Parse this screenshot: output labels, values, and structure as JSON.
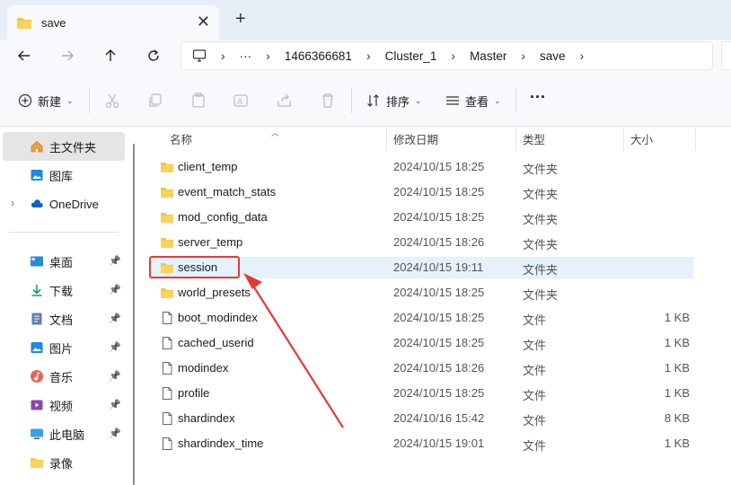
{
  "tab": {
    "title": "save",
    "close": "✕",
    "new_tab": "+"
  },
  "address": {
    "crumbs": [
      "1466366681",
      "Cluster_1",
      "Master",
      "save"
    ],
    "ellipsis": "···"
  },
  "toolbar": {
    "new_label": "新建",
    "sort_label": "排序",
    "view_label": "查看",
    "more": "···"
  },
  "sidebar": {
    "items": [
      {
        "label": "主文件夹",
        "icon": "home-icon",
        "pinned": false,
        "selected": true
      },
      {
        "label": "图库",
        "icon": "gallery-icon",
        "pinned": false
      },
      {
        "label": "OneDrive",
        "icon": "cloud-icon",
        "pinned": false,
        "expandable": true
      },
      {
        "label": "桌面",
        "icon": "desktop-icon",
        "pinned": true
      },
      {
        "label": "下载",
        "icon": "download-icon",
        "pinned": true
      },
      {
        "label": "文档",
        "icon": "document-icon",
        "pinned": true
      },
      {
        "label": "图片",
        "icon": "pictures-icon",
        "pinned": true
      },
      {
        "label": "音乐",
        "icon": "music-icon",
        "pinned": true
      },
      {
        "label": "视频",
        "icon": "video-icon",
        "pinned": true
      },
      {
        "label": "此电脑",
        "icon": "computer-icon",
        "pinned": true
      },
      {
        "label": "录像",
        "icon": "folder-icon",
        "pinned": false
      }
    ]
  },
  "columns": {
    "name": "名称",
    "date": "修改日期",
    "type": "类型",
    "size": "大小"
  },
  "files": [
    {
      "name": "client_temp",
      "date": "2024/10/15 18:25",
      "type": "文件夹",
      "size": "",
      "kind": "folder"
    },
    {
      "name": "event_match_stats",
      "date": "2024/10/15 18:25",
      "type": "文件夹",
      "size": "",
      "kind": "folder"
    },
    {
      "name": "mod_config_data",
      "date": "2024/10/15 18:25",
      "type": "文件夹",
      "size": "",
      "kind": "folder"
    },
    {
      "name": "server_temp",
      "date": "2024/10/15 18:26",
      "type": "文件夹",
      "size": "",
      "kind": "folder"
    },
    {
      "name": "session",
      "date": "2024/10/15 19:11",
      "type": "文件夹",
      "size": "",
      "kind": "folder",
      "selected": true
    },
    {
      "name": "world_presets",
      "date": "2024/10/15 18:25",
      "type": "文件夹",
      "size": "",
      "kind": "folder"
    },
    {
      "name": "boot_modindex",
      "date": "2024/10/15 18:25",
      "type": "文件",
      "size": "1 KB",
      "kind": "file"
    },
    {
      "name": "cached_userid",
      "date": "2024/10/15 18:25",
      "type": "文件",
      "size": "1 KB",
      "kind": "file"
    },
    {
      "name": "modindex",
      "date": "2024/10/15 18:26",
      "type": "文件",
      "size": "1 KB",
      "kind": "file"
    },
    {
      "name": "profile",
      "date": "2024/10/15 18:25",
      "type": "文件",
      "size": "1 KB",
      "kind": "file"
    },
    {
      "name": "shardindex",
      "date": "2024/10/16 15:42",
      "type": "文件",
      "size": "8 KB",
      "kind": "file"
    },
    {
      "name": "shardindex_time",
      "date": "2024/10/15 19:01",
      "type": "文件",
      "size": "1 KB",
      "kind": "file"
    }
  ],
  "colors": {
    "folder": "#f6c344",
    "accent": "#0067c0",
    "highlight": "#e53935",
    "selected_row": "#e5f1fb"
  }
}
